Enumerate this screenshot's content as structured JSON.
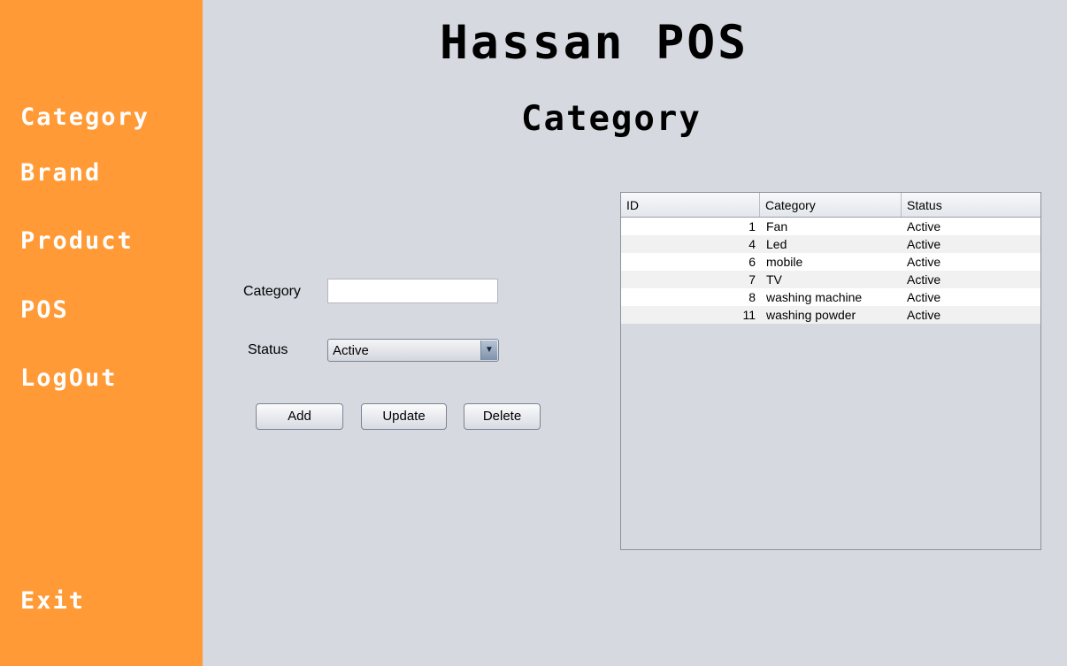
{
  "app_title": "Hassan POS",
  "page_title": "Category",
  "sidebar": {
    "items": [
      {
        "label": "Category"
      },
      {
        "label": "Brand"
      },
      {
        "label": "Product"
      },
      {
        "label": "POS"
      },
      {
        "label": "LogOut"
      },
      {
        "label": "Exit"
      }
    ]
  },
  "form": {
    "category_label": "Category",
    "category_value": "",
    "status_label": "Status",
    "status_value": "Active",
    "buttons": {
      "add": "Add",
      "update": "Update",
      "delete": "Delete"
    }
  },
  "table": {
    "headers": [
      "ID",
      "Category",
      "Status"
    ],
    "rows": [
      [
        "1",
        "Fan",
        "Active"
      ],
      [
        "4",
        "Led",
        "Active"
      ],
      [
        "6",
        "mobile",
        "Active"
      ],
      [
        "7",
        "TV",
        "Active"
      ],
      [
        "8",
        "washing machine",
        "Active"
      ],
      [
        "11",
        "washing powder",
        "Active"
      ]
    ]
  },
  "colors": {
    "sidebar": "#ff9a36",
    "background": "#d6d9e0"
  },
  "icons": {
    "status_dropdown": "chevron-down-icon"
  }
}
